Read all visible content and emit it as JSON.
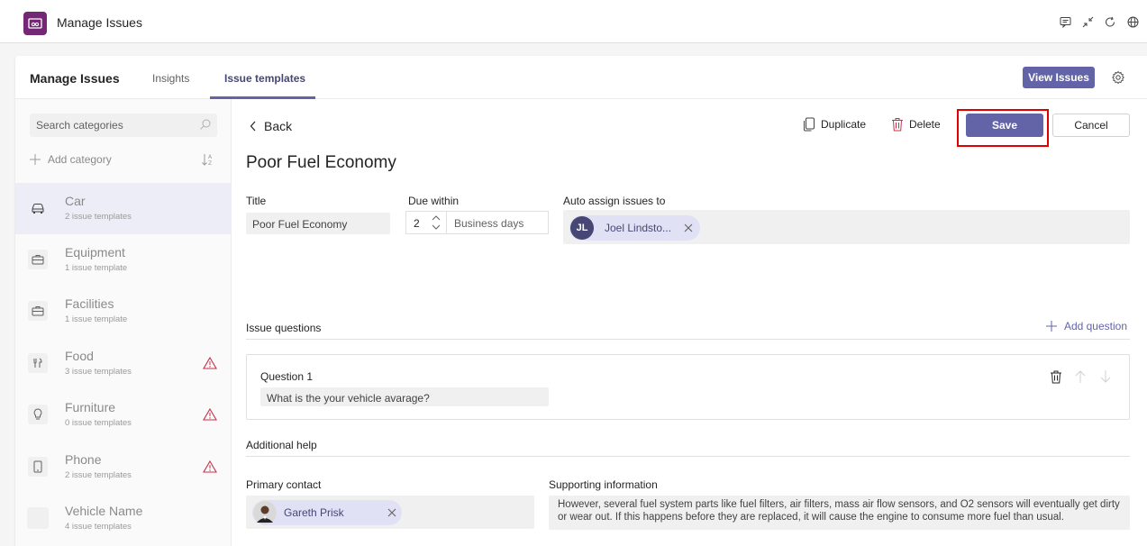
{
  "app": {
    "title": "Manage Issues"
  },
  "titlebar_icons": [
    "chat-icon",
    "collapse-icon",
    "refresh-icon",
    "globe-icon"
  ],
  "tabs": {
    "brand": "Manage Issues",
    "items": [
      {
        "label": "Insights"
      },
      {
        "label": "Issue templates",
        "active": true
      }
    ],
    "view_issues": "View Issues"
  },
  "sidebar": {
    "search_placeholder": "Search categories",
    "add_category": "Add category",
    "categories": [
      {
        "name": "Car",
        "count": "2 issue templates",
        "icon": "car-icon",
        "active": true,
        "warning": false
      },
      {
        "name": "Equipment",
        "count": "1 issue template",
        "icon": "briefcase-icon",
        "warning": false
      },
      {
        "name": "Facilities",
        "count": "1 issue template",
        "icon": "briefcase-icon",
        "warning": false
      },
      {
        "name": "Food",
        "count": "3 issue templates",
        "icon": "fork-knife-icon",
        "warning": true
      },
      {
        "name": "Furniture",
        "count": "0 issue templates",
        "icon": "lightbulb-icon",
        "warning": true
      },
      {
        "name": "Phone",
        "count": "2 issue templates",
        "icon": "phone-icon",
        "warning": true
      },
      {
        "name": "Vehicle Name",
        "count": "4 issue templates",
        "icon": "blank-icon",
        "warning": false
      }
    ]
  },
  "editor": {
    "back": "Back",
    "duplicate": "Duplicate",
    "delete": "Delete",
    "save": "Save",
    "cancel": "Cancel",
    "heading": "Poor Fuel Economy",
    "title_label": "Title",
    "title_value": "Poor Fuel Economy",
    "due_label": "Due within",
    "due_value": "2",
    "due_unit": "Business days",
    "assign_label": "Auto assign issues to",
    "assignee": {
      "initials": "JL",
      "name": "Joel Lindsto..."
    },
    "questions_label": "Issue questions",
    "add_question": "Add question",
    "question": {
      "title": "Question 1",
      "text": "What is the your vehicle avarage?"
    },
    "additional_help": "Additional help",
    "primary_contact_label": "Primary contact",
    "primary_contact": "Gareth Prisk",
    "supporting_label": "Supporting information",
    "supporting_text": "However, several fuel system parts like fuel filters, air filters, mass air flow sensors, and O2 sensors will eventually get dirty or wear out. If this happens before they are replaced, it will cause the engine to consume more fuel than usual."
  },
  "colors": {
    "accent": "#6264a7",
    "brand": "#742774",
    "highlight": "#e00000",
    "warning": "#c4314b"
  }
}
